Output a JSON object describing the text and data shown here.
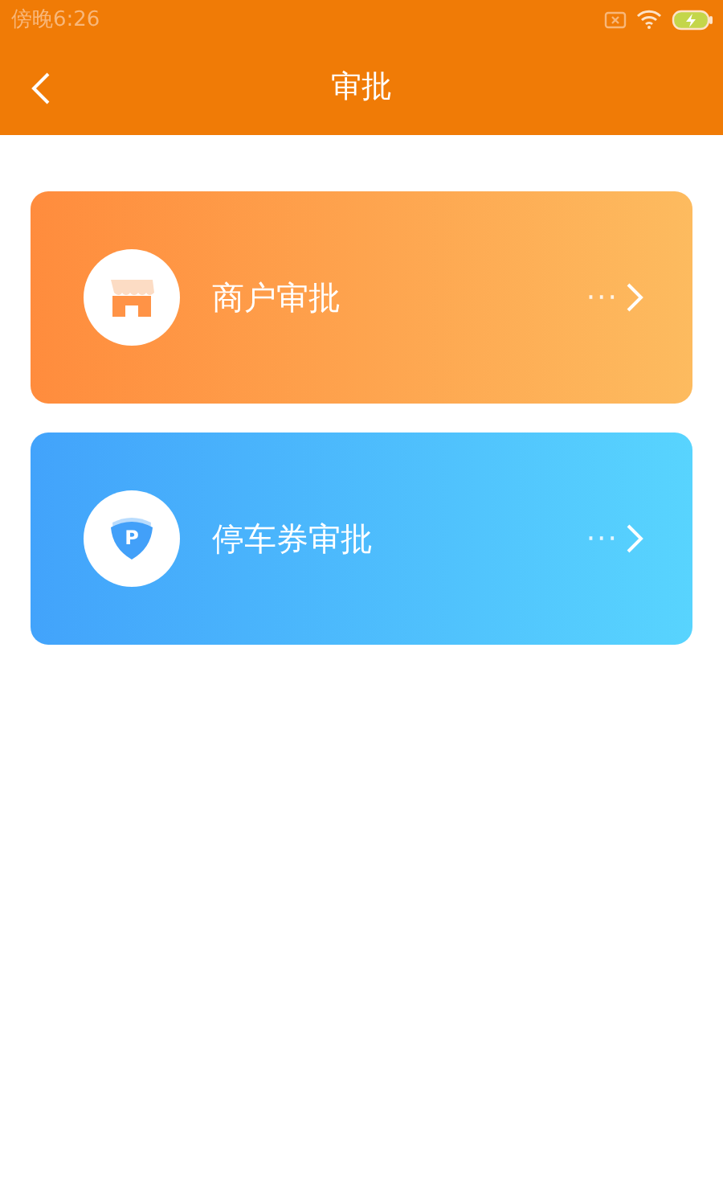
{
  "status_bar": {
    "time": "傍晚6:26"
  },
  "nav": {
    "title": "审批"
  },
  "cards": [
    {
      "kind": "shop",
      "label": "商户审批",
      "more": "···"
    },
    {
      "kind": "parking",
      "label": "停车券审批",
      "icon_letter": "P",
      "more": "···"
    }
  ]
}
